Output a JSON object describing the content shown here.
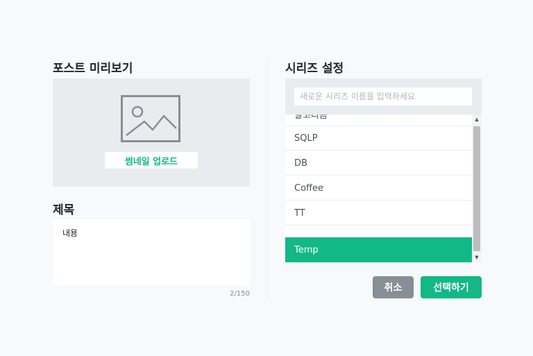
{
  "preview": {
    "title": "포스트 미리보기",
    "thumbnail_icon": "image-icon",
    "upload_label": "썸네일 업로드"
  },
  "description": {
    "title": "제목",
    "value": "내용",
    "counter": "2/150"
  },
  "series": {
    "title": "시리즈 설정",
    "input_placeholder": "새로운 시리즈 이름을 입력하세요",
    "items": [
      {
        "label": "알고리즘"
      },
      {
        "label": "SQLP"
      },
      {
        "label": "DB"
      },
      {
        "label": "Coffee"
      },
      {
        "label": "TT"
      },
      {
        "label": "Temp",
        "selected": true
      }
    ]
  },
  "actions": {
    "cancel_label": "취소",
    "select_label": "선택하기"
  },
  "colors": {
    "accent": "#12b886",
    "panel_bg": "#e9ecef",
    "cancel_bg": "#868e96"
  }
}
